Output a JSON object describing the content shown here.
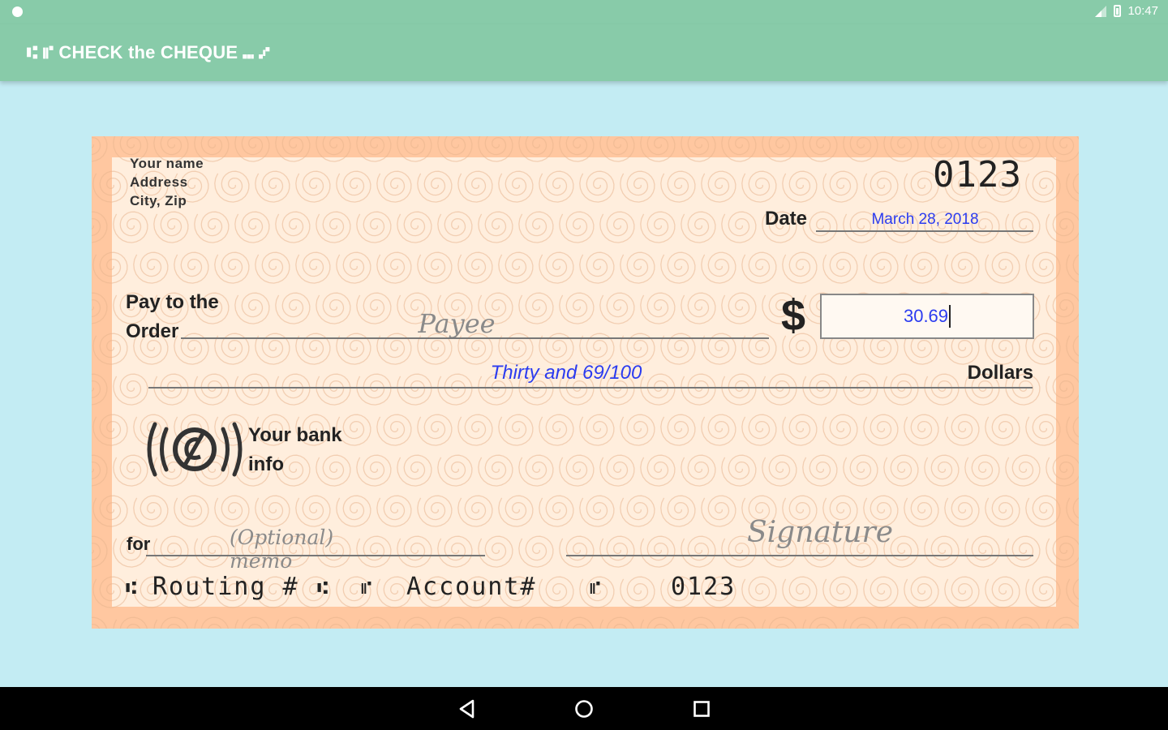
{
  "status_bar": {
    "time": "10:47"
  },
  "app_bar": {
    "title": "⑆ ⑈ CHECK the CHEQUE ⑉ ⑇"
  },
  "cheque": {
    "owner_lines": [
      "Your name",
      "Address",
      "City, Zip"
    ],
    "number": "0123",
    "date_label": "Date",
    "date_value": "March 28, 2018",
    "pay_label_line1": "Pay to the",
    "pay_label_line2": "Order",
    "payee_placeholder": "Payee",
    "currency_symbol": "$",
    "amount_value": "30.69",
    "amount_words": "Thirty and 69/100",
    "dollars_label": "Dollars",
    "bank_info_line1": "Your bank",
    "bank_info_line2": "info",
    "for_label": "for",
    "memo_placeholder": "(Optional) memo",
    "signature_placeholder": "Signature",
    "micr": {
      "routing_symbol_open": "⑆",
      "routing_label": "Routing #",
      "routing_symbol_close": "⑆",
      "account_symbol_open": "⑈",
      "account_label": "Account#",
      "account_symbol_close": "⑈",
      "cheque_number": "0123"
    }
  },
  "nav_bar": {
    "back": "back",
    "home": "home",
    "recents": "recents"
  }
}
